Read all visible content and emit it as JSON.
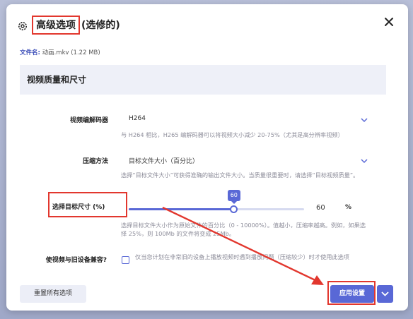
{
  "dialog": {
    "title_main": "高级选项",
    "title_sub": "(选修的)",
    "file_label": "文件名:",
    "file_value": "动画.mkv (1.22 MB)"
  },
  "section": {
    "title": "视频质量和尺寸"
  },
  "encoder": {
    "label": "视频编解码器",
    "value": "H264",
    "hint": "与 H264 相比，H265 编解码器可以将视频大小减少 20-75%（尤其是高分辨率视频）"
  },
  "compression": {
    "label": "压缩方法",
    "value": "目标文件大小（百分比）",
    "hint": "选择“目标文件大小”可获得准确的输出文件大小。当质量很重要时，请选择“目标视频质量”。"
  },
  "target_size": {
    "label": "选择目标尺寸 (%)",
    "value": 60,
    "tooltip": "60",
    "display_value": "60",
    "unit": "%",
    "hint": "选择目标文件大小作为原始文件的百分比（0 - 10000%）。值越小，压缩率越高。例如，如果选择 25%，则 100Mb 的文件将变成 25Mb。"
  },
  "legacy": {
    "label": "使视频与旧设备兼容?",
    "hint": "仅当您计划在非常旧的设备上播放视频时遇到播放问题（压缩较少）时才使用此选项",
    "checked": false
  },
  "buttons": {
    "reset": "重置所有选项",
    "apply": "应用设置"
  },
  "colors": {
    "accent": "#5968d6",
    "highlight": "#e2372e"
  }
}
